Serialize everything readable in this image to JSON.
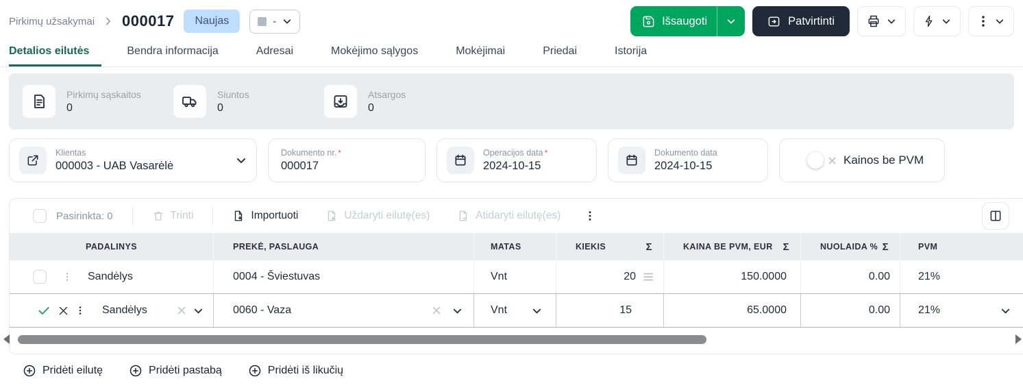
{
  "header": {
    "breadcrumb": "Pirkimų užsakymai",
    "doc_number": "000017",
    "status_badge": "Naujas",
    "status_value": "-",
    "save_label": "Išsaugoti",
    "confirm_label": "Patvirtinti"
  },
  "tabs": [
    {
      "label": "Detalios eilutės"
    },
    {
      "label": "Bendra informacija"
    },
    {
      "label": "Adresai"
    },
    {
      "label": "Mokėjimo sąlygos"
    },
    {
      "label": "Mokėjimai"
    },
    {
      "label": "Priedai"
    },
    {
      "label": "Istorija"
    }
  ],
  "stats": [
    {
      "icon": "document-icon",
      "label": "Pirkimų sąskaitos",
      "value": "0"
    },
    {
      "icon": "truck-icon",
      "label": "Siuntos",
      "value": "0"
    },
    {
      "icon": "inbox-icon",
      "label": "Atsargos",
      "value": "0"
    }
  ],
  "fields": {
    "client": {
      "label": "Klientas",
      "value": "000003 - UAB Vasarėlė"
    },
    "doc_nr": {
      "label": "Dokumento nr.",
      "required_mark": "*",
      "value": "000017"
    },
    "op_date": {
      "label": "Operacijos data",
      "required_mark": "*",
      "value": "2024-10-15"
    },
    "doc_date": {
      "label": "Dokumento data",
      "value": "2024-10-15"
    },
    "vat_toggle": {
      "label": "Kainos be PVM",
      "state": "off"
    }
  },
  "toolbar": {
    "selected": "Pasirinkta: 0",
    "delete": "Trinti",
    "import": "Importuoti",
    "close_lines": "Uždaryti eilutę(es)",
    "open_lines": "Atidaryti eilutę(es)"
  },
  "table": {
    "sum_glyph": "Σ",
    "columns": [
      "PADALINYS",
      "PREKĖ, PASLAUGA",
      "MATAS",
      "KIEKIS",
      "KAINA BE PVM, EUR",
      "NUOLAIDA %",
      "PVM"
    ],
    "rows": [
      {
        "department": "Sandėlys",
        "item": "0004 - Šviestuvas",
        "unit": "Vnt",
        "qty": "20",
        "price": "150.0000",
        "discount": "0.00",
        "vat": "21%"
      },
      {
        "department": "Sandėlys",
        "item": "0060 - Vaza",
        "unit": "Vnt",
        "qty": "15",
        "price": "65.0000",
        "discount": "0.00",
        "vat": "21%",
        "editing": true
      }
    ]
  },
  "footer": {
    "add_line": "Pridėti eilutę",
    "add_note": "Pridėti pastabą",
    "add_from_stock": "Pridėti iš likučių"
  },
  "colors": {
    "accent_green": "#00a55e",
    "dark_navy": "#212a39",
    "badge_bg": "#bfddfc",
    "badge_text": "#35528c",
    "active_tab": "#186b51",
    "bar_gray": "#ebeced"
  }
}
